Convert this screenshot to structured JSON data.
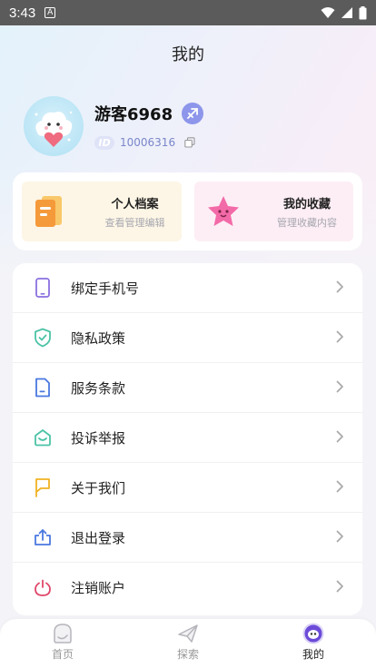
{
  "status_bar": {
    "time": "3:43",
    "notification_letter": "A"
  },
  "page": {
    "title": "我的"
  },
  "user": {
    "name": "游客6968",
    "id_label": "ID",
    "id_value": "10006316"
  },
  "cards": [
    {
      "title": "个人档案",
      "subtitle": "查看管理编辑"
    },
    {
      "title": "我的收藏",
      "subtitle": "管理收藏内容"
    }
  ],
  "menu": [
    {
      "label": "绑定手机号",
      "icon": "phone-icon",
      "color": "#8a6fe0"
    },
    {
      "label": "隐私政策",
      "icon": "shield-check-icon",
      "color": "#4cc3a6"
    },
    {
      "label": "服务条款",
      "icon": "document-icon",
      "color": "#4a78e0"
    },
    {
      "label": "投诉举报",
      "icon": "complaint-icon",
      "color": "#4cc3a6"
    },
    {
      "label": "关于我们",
      "icon": "flag-icon",
      "color": "#f0b323"
    },
    {
      "label": "退出登录",
      "icon": "upload-icon",
      "color": "#4a78e0"
    },
    {
      "label": "注销账户",
      "icon": "power-icon",
      "color": "#e0476a"
    }
  ],
  "tabs": [
    {
      "label": "首页",
      "icon": "home-icon"
    },
    {
      "label": "探索",
      "icon": "plane-icon"
    },
    {
      "label": "我的",
      "icon": "mine-icon",
      "active": true
    }
  ],
  "colors": {
    "accent": "#8d96ea",
    "id_text": "#7a86c9"
  }
}
